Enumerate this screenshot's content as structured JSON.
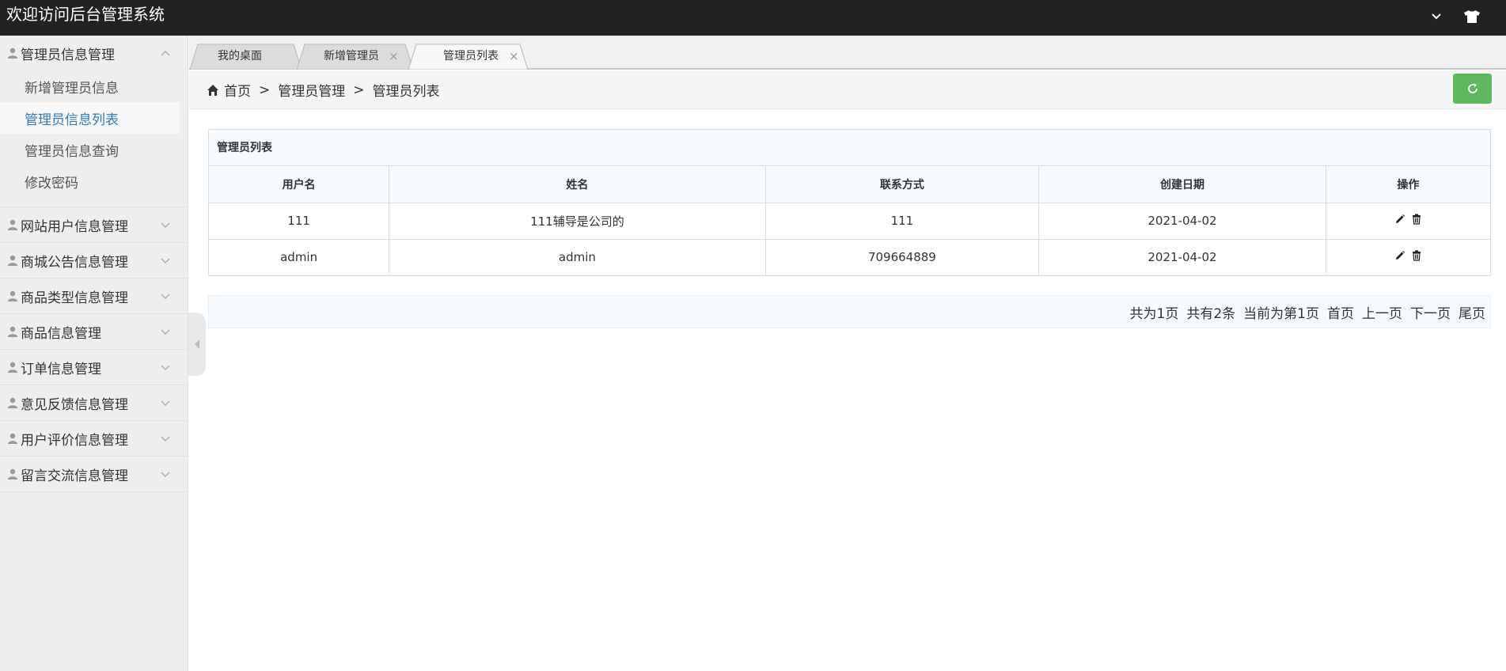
{
  "header": {
    "title": "欢迎访问后台管理系统"
  },
  "sidebar": {
    "groups": [
      {
        "label": "管理员信息管理",
        "expanded": true,
        "items": [
          {
            "label": "新增管理员信息"
          },
          {
            "label": "管理员信息列表",
            "active": true
          },
          {
            "label": "管理员信息查询"
          },
          {
            "label": "修改密码"
          }
        ]
      },
      {
        "label": "网站用户信息管理"
      },
      {
        "label": "商城公告信息管理"
      },
      {
        "label": "商品类型信息管理"
      },
      {
        "label": "商品信息管理"
      },
      {
        "label": "订单信息管理"
      },
      {
        "label": "意见反馈信息管理"
      },
      {
        "label": "用户评价信息管理"
      },
      {
        "label": "留言交流信息管理"
      }
    ]
  },
  "tabs": [
    {
      "label": "我的桌面",
      "closable": false
    },
    {
      "label": "新增管理员",
      "closable": true
    },
    {
      "label": "管理员列表",
      "closable": true,
      "active": true
    }
  ],
  "tab_close_glyph": "×",
  "breadcrumb": {
    "home": "首页",
    "sep": ">",
    "level1": "管理员管理",
    "level2": "管理员列表"
  },
  "table": {
    "title": "管理员列表",
    "headers": [
      "用户名",
      "姓名",
      "联系方式",
      "创建日期",
      "操作"
    ],
    "rows": [
      [
        "111",
        "111辅导是公司的",
        "111",
        "2021-04-02"
      ],
      [
        "admin",
        "admin",
        "709664889",
        "2021-04-02"
      ]
    ]
  },
  "pager": {
    "total_pages": "共为1页",
    "total_items": "共有2条",
    "current": "当前为第1页",
    "first": "首页",
    "prev": "上一页",
    "next": "下一页",
    "last": "尾页"
  },
  "colors": {
    "header_bg": "#222222",
    "sidebar_bg": "#eeeeee",
    "active_link": "#337ab7",
    "refresh_btn": "#5eb95e"
  },
  "icons": {
    "header_dropdown": "chevron-down-icon",
    "header_skin": "tshirt-icon",
    "menu_group": "user-icon",
    "breadcrumb_home": "home-icon",
    "refresh": "refresh-icon",
    "edit": "pencil-icon",
    "delete": "trash-icon"
  }
}
